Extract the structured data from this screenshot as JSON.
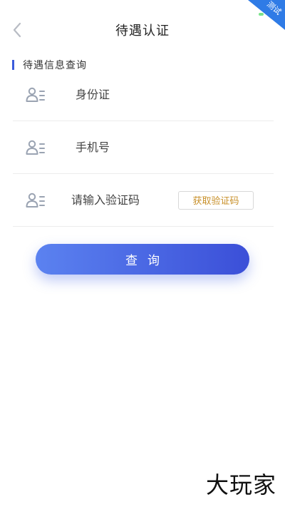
{
  "header": {
    "title": "待遇认证",
    "corner_badge": "测试"
  },
  "section": {
    "label": "待遇信息查询"
  },
  "form": {
    "id_field": {
      "placeholder": "身份证",
      "value": ""
    },
    "phone_field": {
      "placeholder": "手机号",
      "value": ""
    },
    "code_field": {
      "placeholder": "请输入验证码",
      "value": ""
    },
    "get_code_label": "获取验证码"
  },
  "actions": {
    "query_label": "查询"
  },
  "watermark": {
    "text": "大玩家"
  },
  "colors": {
    "accent": "#3b5bdb",
    "button_start": "#5b82f0",
    "button_end": "#3b4fd8",
    "code_text": "#c8902a",
    "icon_gray": "#9aa3b2"
  }
}
